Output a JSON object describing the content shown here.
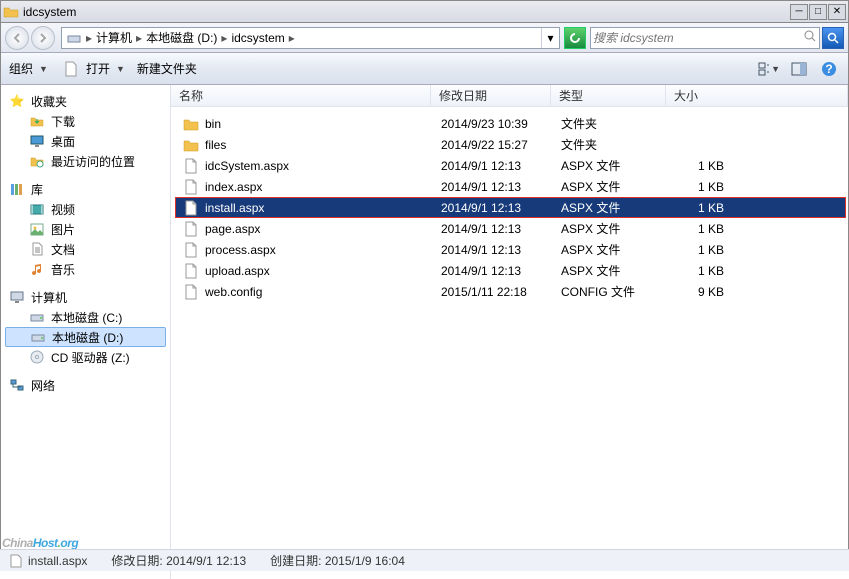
{
  "window": {
    "title": "idcsystem"
  },
  "nav": {
    "crumbs": [
      "计算机",
      "本地磁盘 (D:)",
      "idcsystem"
    ],
    "search_placeholder": "搜索 idcsystem"
  },
  "toolbar": {
    "organize": "组织",
    "open": "打开",
    "newfolder": "新建文件夹"
  },
  "sidebar": {
    "favorites": {
      "label": "收藏夹",
      "items": [
        "下载",
        "桌面",
        "最近访问的位置"
      ]
    },
    "libraries": {
      "label": "库",
      "items": [
        "视频",
        "图片",
        "文档",
        "音乐"
      ]
    },
    "computer": {
      "label": "计算机",
      "items": [
        "本地磁盘 (C:)",
        "本地磁盘 (D:)",
        "CD 驱动器 (Z:)"
      ],
      "selected_index": 1
    },
    "network": {
      "label": "网络"
    }
  },
  "columns": {
    "name": "名称",
    "date": "修改日期",
    "type": "类型",
    "size": "大小"
  },
  "files": [
    {
      "name": "bin",
      "date": "2014/9/23 10:39",
      "type": "文件夹",
      "size": "",
      "icon": "folder"
    },
    {
      "name": "files",
      "date": "2014/9/22 15:27",
      "type": "文件夹",
      "size": "",
      "icon": "folder"
    },
    {
      "name": "idcSystem.aspx",
      "date": "2014/9/1 12:13",
      "type": "ASPX 文件",
      "size": "1 KB",
      "icon": "file"
    },
    {
      "name": "index.aspx",
      "date": "2014/9/1 12:13",
      "type": "ASPX 文件",
      "size": "1 KB",
      "icon": "file"
    },
    {
      "name": "install.aspx",
      "date": "2014/9/1 12:13",
      "type": "ASPX 文件",
      "size": "1 KB",
      "icon": "file",
      "selected": true
    },
    {
      "name": "page.aspx",
      "date": "2014/9/1 12:13",
      "type": "ASPX 文件",
      "size": "1 KB",
      "icon": "file"
    },
    {
      "name": "process.aspx",
      "date": "2014/9/1 12:13",
      "type": "ASPX 文件",
      "size": "1 KB",
      "icon": "file"
    },
    {
      "name": "upload.aspx",
      "date": "2014/9/1 12:13",
      "type": "ASPX 文件",
      "size": "1 KB",
      "icon": "file"
    },
    {
      "name": "web.config",
      "date": "2015/1/11 22:18",
      "type": "CONFIG 文件",
      "size": "9 KB",
      "icon": "file"
    }
  ],
  "status": {
    "name": "install.aspx",
    "mod_label": "修改日期:",
    "mod_value": "2014/9/1 12:13",
    "created_label": "创建日期:",
    "created_value": "2015/1/9 16:04"
  },
  "watermark": [
    "China",
    "Host",
    ".",
    "org"
  ]
}
